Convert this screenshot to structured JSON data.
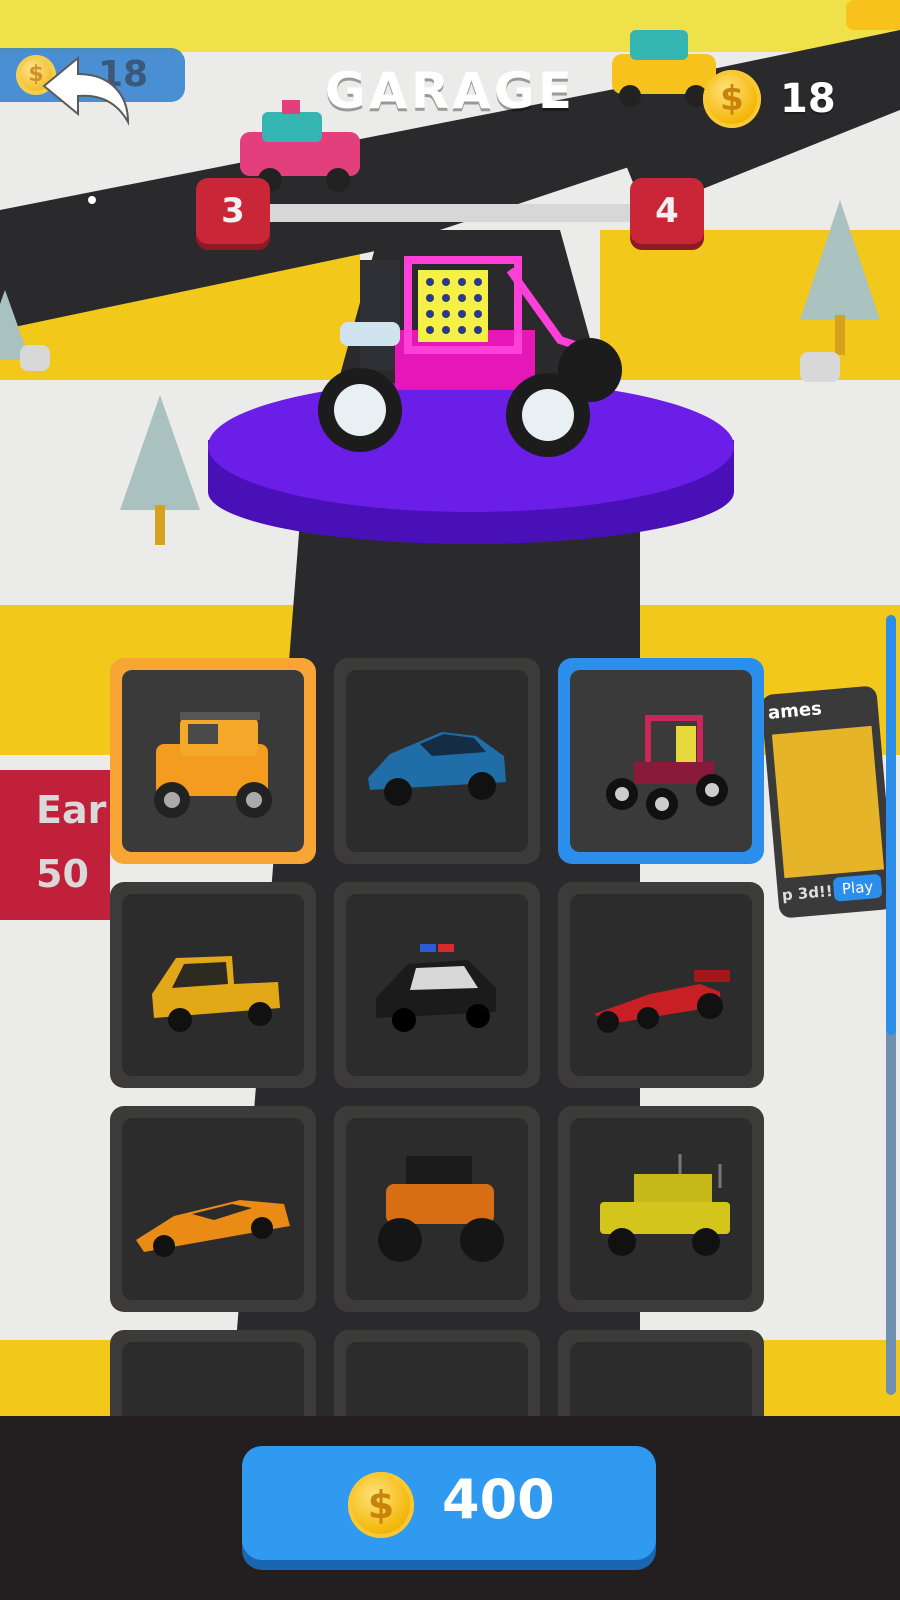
{
  "header": {
    "title": "GARAGE",
    "coins": "18",
    "back_pill_coins": "18",
    "back_icon": "back-arrow-icon",
    "coin_icon": "coin-icon"
  },
  "level_progress": {
    "current": "3",
    "next": "4"
  },
  "vehicles": [
    {
      "name": "off-road-jeep",
      "color": "#f39c1f",
      "selected": "yellow"
    },
    {
      "name": "muscle-car",
      "color": "#1f6ea8",
      "selected": ""
    },
    {
      "name": "dune-buggy",
      "color": "#c9265c",
      "selected": "blue"
    },
    {
      "name": "pickup-truck",
      "color": "#e3a817",
      "selected": ""
    },
    {
      "name": "police-car",
      "color": "#1b1b1b",
      "selected": ""
    },
    {
      "name": "formula-car",
      "color": "#c81f24",
      "selected": ""
    },
    {
      "name": "supercar",
      "color": "#e98b14",
      "selected": ""
    },
    {
      "name": "monster-truck",
      "color": "#d86e13",
      "selected": ""
    },
    {
      "name": "military-humvee",
      "color": "#d4c51c",
      "selected": ""
    }
  ],
  "side_panel": {
    "earn_label": "Ear",
    "earn_amount": "50"
  },
  "ad_card": {
    "title": "ames",
    "caption": "p 3d!!!",
    "play_label": "Play"
  },
  "buy": {
    "price": "400"
  },
  "colors": {
    "accent_blue": "#2f9af0",
    "selected_yellow": "#f7a635",
    "selected_blue": "#2b8eea",
    "platform_purple": "#6a1ee8",
    "badge_red": "#c92638"
  }
}
